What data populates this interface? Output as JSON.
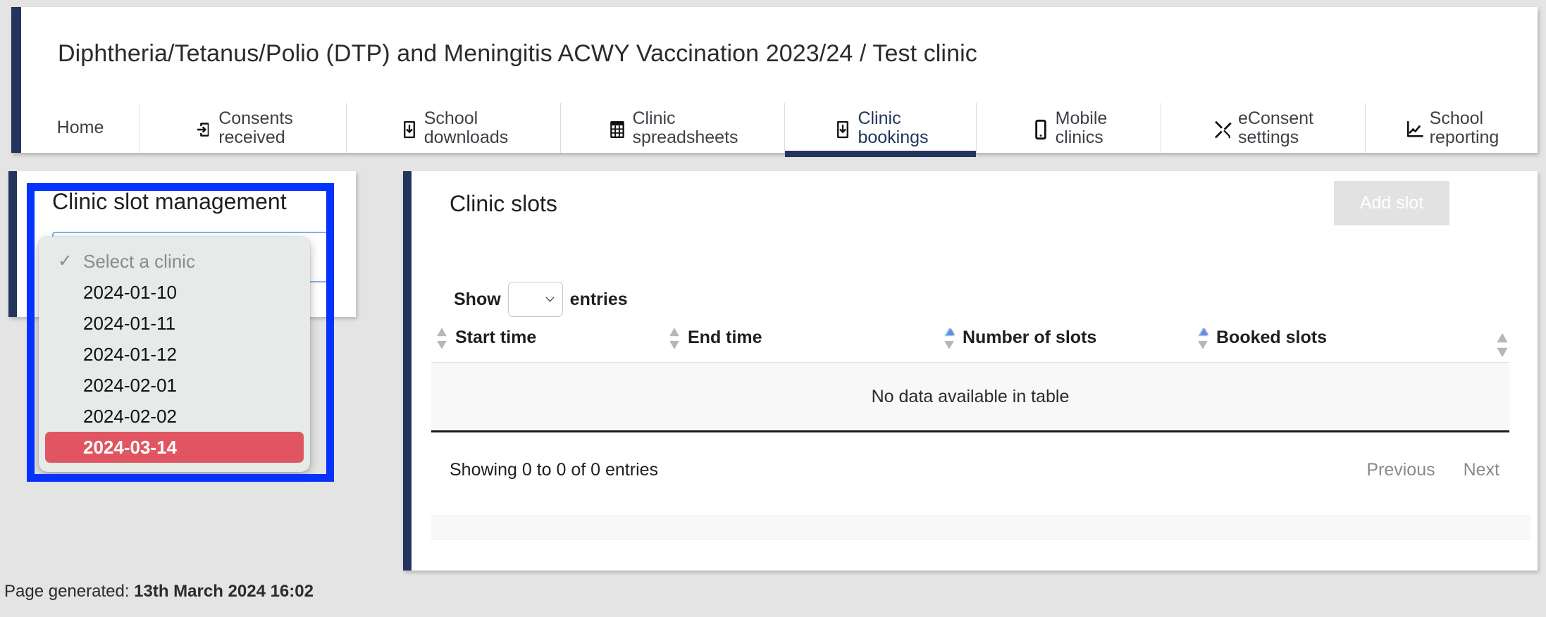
{
  "header": {
    "title": "Diphtheria/Tetanus/Polio (DTP) and Meningitis ACWY Vaccination 2023/24 / Test clinic"
  },
  "nav": {
    "tabs": [
      {
        "label": "Home",
        "icon": "",
        "icon_name": "none",
        "active": false
      },
      {
        "label": "Consents\nreceived",
        "icon": "box-arrow-in-right",
        "icon_name": "box-arrow-in-right-icon",
        "active": false
      },
      {
        "label": "School\ndownloads",
        "icon": "box-arrow-down",
        "icon_name": "box-arrow-down-icon",
        "active": false
      },
      {
        "label": "Clinic\nspreadsheets",
        "icon": "grid-table",
        "icon_name": "grid-table-icon",
        "active": false
      },
      {
        "label": "Clinic\nbookings",
        "icon": "box-arrow-down",
        "icon_name": "box-arrow-down-icon",
        "active": true
      },
      {
        "label": "Mobile\nclinics",
        "icon": "phone",
        "icon_name": "phone-icon",
        "active": false
      },
      {
        "label": "eConsent\nsettings",
        "icon": "tools",
        "icon_name": "tools-icon",
        "active": false
      },
      {
        "label": "School\nreporting",
        "icon": "graph-up",
        "icon_name": "graph-up-icon",
        "active": false
      }
    ]
  },
  "left_panel": {
    "title": "Clinic slot management",
    "select_value": "",
    "dropdown": {
      "open": true,
      "options": [
        {
          "label": "Select a clinic",
          "placeholder": true,
          "checked": true,
          "highlighted": false
        },
        {
          "label": "2024-01-10",
          "placeholder": false,
          "checked": false,
          "highlighted": false
        },
        {
          "label": "2024-01-11",
          "placeholder": false,
          "checked": false,
          "highlighted": false
        },
        {
          "label": "2024-01-12",
          "placeholder": false,
          "checked": false,
          "highlighted": false
        },
        {
          "label": "2024-02-01",
          "placeholder": false,
          "checked": false,
          "highlighted": false
        },
        {
          "label": "2024-02-02",
          "placeholder": false,
          "checked": false,
          "highlighted": false
        },
        {
          "label": "2024-03-14",
          "placeholder": false,
          "checked": false,
          "highlighted": true
        }
      ],
      "check_glyph": "✓",
      "highlight_color": "#e05561"
    }
  },
  "main_panel": {
    "title": "Clinic slots",
    "add_slot_label": "Add slot",
    "add_slot_disabled": true,
    "show_entries": {
      "prefix": "Show",
      "suffix": "entries",
      "value": ""
    },
    "table": {
      "columns": [
        {
          "label": "Start time",
          "sortable": true,
          "sort_state": "none"
        },
        {
          "label": "End time",
          "sortable": true,
          "sort_state": "asc-hover"
        },
        {
          "label": "Number of slots",
          "sortable": true,
          "sort_state": "asc-hover"
        },
        {
          "label": "Booked slots",
          "sortable": true,
          "sort_state": "none"
        }
      ],
      "empty_message": "No data available in table",
      "rows": []
    },
    "footer": {
      "info": "Showing 0 to 0 of 0 entries",
      "previous_label": "Previous",
      "next_label": "Next"
    }
  },
  "page_footer": {
    "label": "Page generated:",
    "value": "13th March 2024 16:02"
  },
  "colors": {
    "brand_navy": "#23355c",
    "page_bg": "#e4e4e4",
    "focus_ring": "#0432ff",
    "dropdown_highlight": "#e05561",
    "sort_accent": "#8ad2e8"
  }
}
